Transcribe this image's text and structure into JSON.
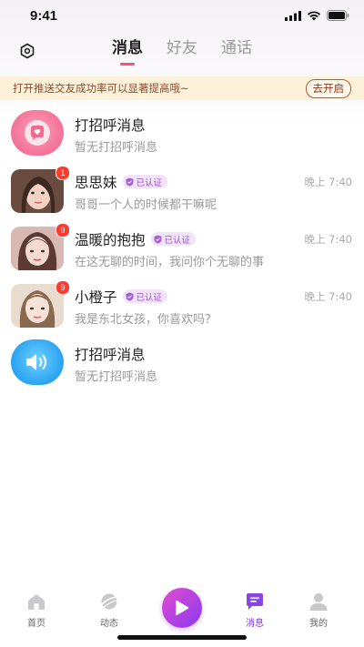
{
  "status": {
    "time": "9:41"
  },
  "tabs": [
    {
      "label": "消息",
      "active": true
    },
    {
      "label": "好友",
      "active": false
    },
    {
      "label": "通话",
      "active": false
    }
  ],
  "notice": {
    "text": "打开推送交友成功率可以显著提高哦~",
    "button": "去开启"
  },
  "conversations": [
    {
      "name": "打招呼消息",
      "message": "暂无打招呼消息",
      "avatar": "heart-message-icon"
    },
    {
      "name": "思思妹",
      "verified": "已认证",
      "time": "晚上 7:40",
      "message": "哥哥一个人的时候都干嘛呢",
      "badge": "1"
    },
    {
      "name": "温暖的抱抱",
      "verified": "已认证",
      "time": "晚上 7:40",
      "message": "在这无聊的时间，我问你个无聊的事",
      "badge": "9"
    },
    {
      "name": "小橙子",
      "verified": "已认证",
      "time": "晚上 7:40",
      "message": "我是东北女孩，你喜欢吗?",
      "badge": "9"
    },
    {
      "name": "打招呼消息",
      "message": "暂无打招呼消息",
      "avatar": "speaker-icon"
    }
  ],
  "tabbar": [
    {
      "label": "首页"
    },
    {
      "label": "动态"
    },
    {
      "label": "消息",
      "active": true
    },
    {
      "label": "我的"
    }
  ],
  "colors": {
    "accent": "#ff4f7a",
    "purple": "#7c3bd8",
    "notice_bg": "#fdf1d9"
  }
}
